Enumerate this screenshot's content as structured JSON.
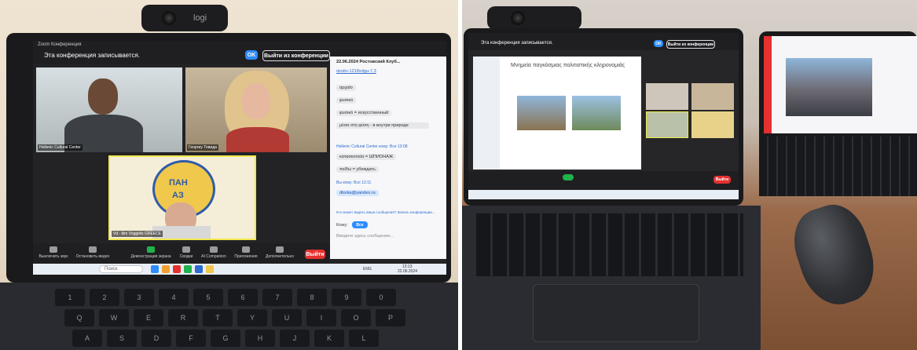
{
  "left_photo": {
    "webcam_brand": "logi",
    "zoom": {
      "window_title": "Zoom Конференция",
      "recording_notice": "Эта конференция записывается.",
      "ok_button": "OK",
      "leave_button": "Выйти из конференции",
      "participants": [
        {
          "name": "Hellenic Cultural Center"
        },
        {
          "name": "Георгиу Тевида"
        },
        {
          "name": "Vd - tiim Voggelis GREECE"
        }
      ],
      "logo_text": [
        "ПАН",
        "АЗ"
      ],
      "chat": {
        "header": "22.06.2024 Ростовский Клуб...",
        "link": "dzoitv-1218xdgu-7.3",
        "messages": [
          {
            "type": "bubble",
            "text": "αρχαίο"
          },
          {
            "type": "bubble",
            "text": "φυσικό"
          },
          {
            "type": "bubble",
            "text": "φυσικό = искусственный"
          },
          {
            "type": "bubble",
            "text": "μέσα στη φύση - в внутри природе"
          },
          {
            "type": "sender",
            "text": "Hellenic Cultural Center кому: Все 13:08"
          },
          {
            "type": "bubble",
            "text": "κατασκοπεία = ШПИОНАЖ"
          },
          {
            "type": "bubble",
            "text": "πείθω = убеждать"
          },
          {
            "type": "sender",
            "text": "Вы кому: Все 13:11"
          },
          {
            "type": "bubble-blue",
            "text": "dtorka@yandex.ru"
          },
          {
            "type": "note",
            "text": "Кто может видеть ваши сообщения? Запись конференции..."
          }
        ],
        "to_label": "Кому:",
        "to_value": "Все",
        "input_placeholder": "Введите здесь сообщение..."
      },
      "toolbar": [
        {
          "label": "Выключить звук"
        },
        {
          "label": "Остановить видео"
        },
        {
          "label": "Демонстрация экрана"
        },
        {
          "label": "Сводки"
        },
        {
          "label": "AI Companion"
        },
        {
          "label": "Приложения"
        },
        {
          "label": "Дополнительно"
        }
      ],
      "leave_short": "Выйти"
    },
    "taskbar": {
      "search_label": "Поиск",
      "lang": "ENG",
      "time": "13:13",
      "date": "22.06.2024"
    },
    "keys_row1": [
      "1",
      "2",
      "3",
      "4",
      "5",
      "6",
      "7",
      "8",
      "9",
      "0"
    ],
    "keys_row2": [
      "Q",
      "W",
      "E",
      "R",
      "T",
      "Y",
      "U",
      "I",
      "O",
      "P"
    ],
    "keys_row3": [
      "A",
      "S",
      "D",
      "F",
      "G",
      "H",
      "J",
      "K",
      "L"
    ]
  },
  "right_photo": {
    "zoom": {
      "recording_notice": "Эта конференция записывается.",
      "ok_button": "OK",
      "leave_button": "Выйти из конференции",
      "slide_title": "Μνημεία παγκόσμιας πολιτιστικής κληρονομιάς",
      "leave_short": "Выйти"
    }
  },
  "colors": {
    "zoom_blue": "#2d8cff",
    "leave_red": "#e5312f",
    "highlight_yellow": "#f0e84b",
    "share_green": "#20b24b"
  }
}
